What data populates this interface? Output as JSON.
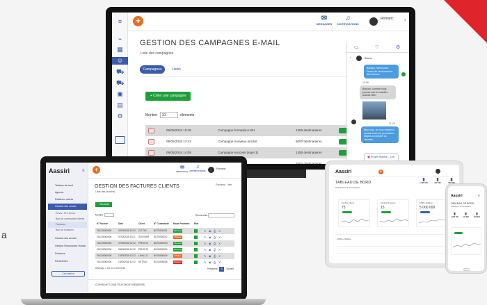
{
  "monitor": {
    "header": {
      "messages": "MESSAGES",
      "notifications": "NOTIFICATIONS",
      "user": "Romaric"
    },
    "title": "GESTION DES CAMPAGNES E-MAIL",
    "subtitle": "Liste des campagnes",
    "tabs": [
      "Campagnes",
      "Listes"
    ],
    "create_button": "+ Créer une campagne",
    "show_prefix": "Montrer",
    "show_value": "10",
    "show_suffix": "éléments",
    "rows": [
      {
        "date": "06/05/2018 10:48",
        "name": "Campagne formation H2H",
        "count": "1350 destinataires"
      },
      {
        "date": "06/05/2018 12:42",
        "name": "Campagne nouveau produit",
        "count": "5000 destinataires"
      },
      {
        "date": "06/05/2018 14:08",
        "name": "Campagne success (sujet 1)",
        "count": "1350 destinataires"
      },
      {
        "date": "",
        "name": "",
        "count": "2500 destinataires"
      }
    ],
    "chat": {
      "contact": "Bruno",
      "messages": [
        {
          "side": "right",
          "text": "Bonjour, Merci pour l'envoi de l'avancement des travaux"
        },
        {
          "side": "time",
          "text": "11:18"
        },
        {
          "side": "left",
          "text": "Bonjour, comme vous pouvez voir le chantier avance bien"
        },
        {
          "side": "time",
          "text": "11:22"
        },
        {
          "side": "right",
          "text": "Bien reçu, je vous envoie le contrat avec les prochaines étapes à compter du chantier."
        },
        {
          "side": "file",
          "text": "Projet finalisé....pdf"
        }
      ]
    }
  },
  "laptop": {
    "logo": "Aassiri",
    "header": {
      "messages": "MESSAGES",
      "notifications": "NOTIFICATIONS",
      "user": "Romaric"
    },
    "sidebar": [
      {
        "label": "Tableau de bord",
        "state": ""
      },
      {
        "label": "Agenda",
        "state": ""
      },
      {
        "label": "Relations clients",
        "state": ""
      },
      {
        "label": "Gestion des ventes",
        "state": "on"
      },
      {
        "label": "Devis / Pro forma",
        "state": "sub"
      },
      {
        "label": "Bon de commande clients",
        "state": "sub"
      },
      {
        "label": "Factures",
        "state": "subon"
      },
      {
        "label": "Bon de livraison",
        "state": "sub"
      },
      {
        "label": "Gestion des achats",
        "state": ""
      },
      {
        "label": "Gestion Ressources Humai.",
        "state": ""
      },
      {
        "label": "Finances",
        "state": ""
      },
      {
        "label": "Paramètres",
        "state": ""
      }
    ],
    "calc_button": "Calculatrice",
    "title": "GESTION DES FACTURES CLIENTS",
    "subtitle": "Liste des factures",
    "breadcrumb": "Factures / Liste",
    "new_button": "+ Nouveau",
    "show_label": "Montrer",
    "search_label": "Rechercher",
    "columns": [
      "N° Facture",
      "Date",
      "Client",
      "N° Commande",
      "Mode Paiement",
      "Etat"
    ],
    "rows": [
      {
        "no": "FAC/00000000",
        "date": "02/05/2018 12:22",
        "client": "CLT 001",
        "cmd": "BC/00000001",
        "mode": "Virement",
        "color": "#1f9f3a"
      },
      {
        "no": "FAC/00000000",
        "date": "07/05/2018 13:21",
        "client": "SOLYMAR",
        "cmd": "BC/00000002",
        "mode": "Chèque",
        "color": "#e86f1f"
      },
      {
        "no": "FAC/00000000",
        "date": "07/05/2018 12:22",
        "client": "PRIVE 02",
        "cmd": "BC/00000003",
        "mode": "Virement",
        "color": "#1f9f3a"
      },
      {
        "no": "FAC/00000000",
        "date": "08/05/2018 12:22",
        "client": "PRIVE 03",
        "cmd": "BC/00000004",
        "mode": "Virement",
        "color": "#1f9f3a"
      },
      {
        "no": "FAC/00000000",
        "date": "12/05/2018 12:22",
        "client": "LAVAL 11",
        "cmd": "BC/00000005",
        "mode": "Chèque",
        "color": "#e86f1f"
      },
      {
        "no": "FAC/00000000",
        "date": "13/05/2018 12:22",
        "client": "SETRAC",
        "cmd": "BC/00000006",
        "mode": "Espèces",
        "color": "#e0242b"
      }
    ],
    "footer": "Affichage 1 à 6 sur 6 éléments",
    "pager_prev": "Précédent",
    "pager_page": "1",
    "pager_next": "Suivant",
    "status": "COPYRIGHT © 2018 TOUS DROITS RÉSERVÉS"
  },
  "tablet": {
    "logo": "Aassiri",
    "title": "TABLEAU DE BORD",
    "subtitle": "Statistiques & Visualisation",
    "kpis": [
      {
        "value": "1 200 000",
        "label": "CA"
      },
      {
        "value": "120 000",
        "label": "Achats"
      },
      {
        "value": "600 000",
        "label": "Dépenses"
      }
    ],
    "cards": [
      {
        "label": "Nombre Clients",
        "value": "75",
        "color": "#1f9f3a"
      },
      {
        "label": "Nombre Prospects",
        "value": "15",
        "color": "#1f9f3a"
      },
      {
        "label": "Chiffre d'affaires",
        "value": "5 000 000",
        "color": "#3b5ba9"
      }
    ],
    "chart_label": "Chiffre d'Affaire"
  },
  "phone": {
    "logo": "Aassiri",
    "title": "TABLEAU DE BORD",
    "subtitle": "Statistiques & Visualisation",
    "kpis": [
      {
        "value": "1 200 000"
      },
      {
        "value": "120 000"
      },
      {
        "value": "600 000"
      }
    ]
  },
  "left_fragment": "a"
}
